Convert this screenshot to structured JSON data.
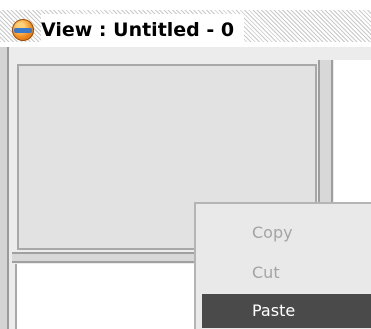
{
  "window": {
    "title": "View : Untitled - 0",
    "icon": "app-globe-icon"
  },
  "context_menu": {
    "items": [
      {
        "label": "Copy",
        "enabled": false
      },
      {
        "label": "Cut",
        "enabled": false
      },
      {
        "label": "Paste",
        "enabled": true,
        "highlighted": true
      }
    ]
  },
  "colors": {
    "menu_highlight": "#4a4a4a",
    "disabled_text": "#a4a4a4",
    "pane_background": "#e2e2e2"
  }
}
